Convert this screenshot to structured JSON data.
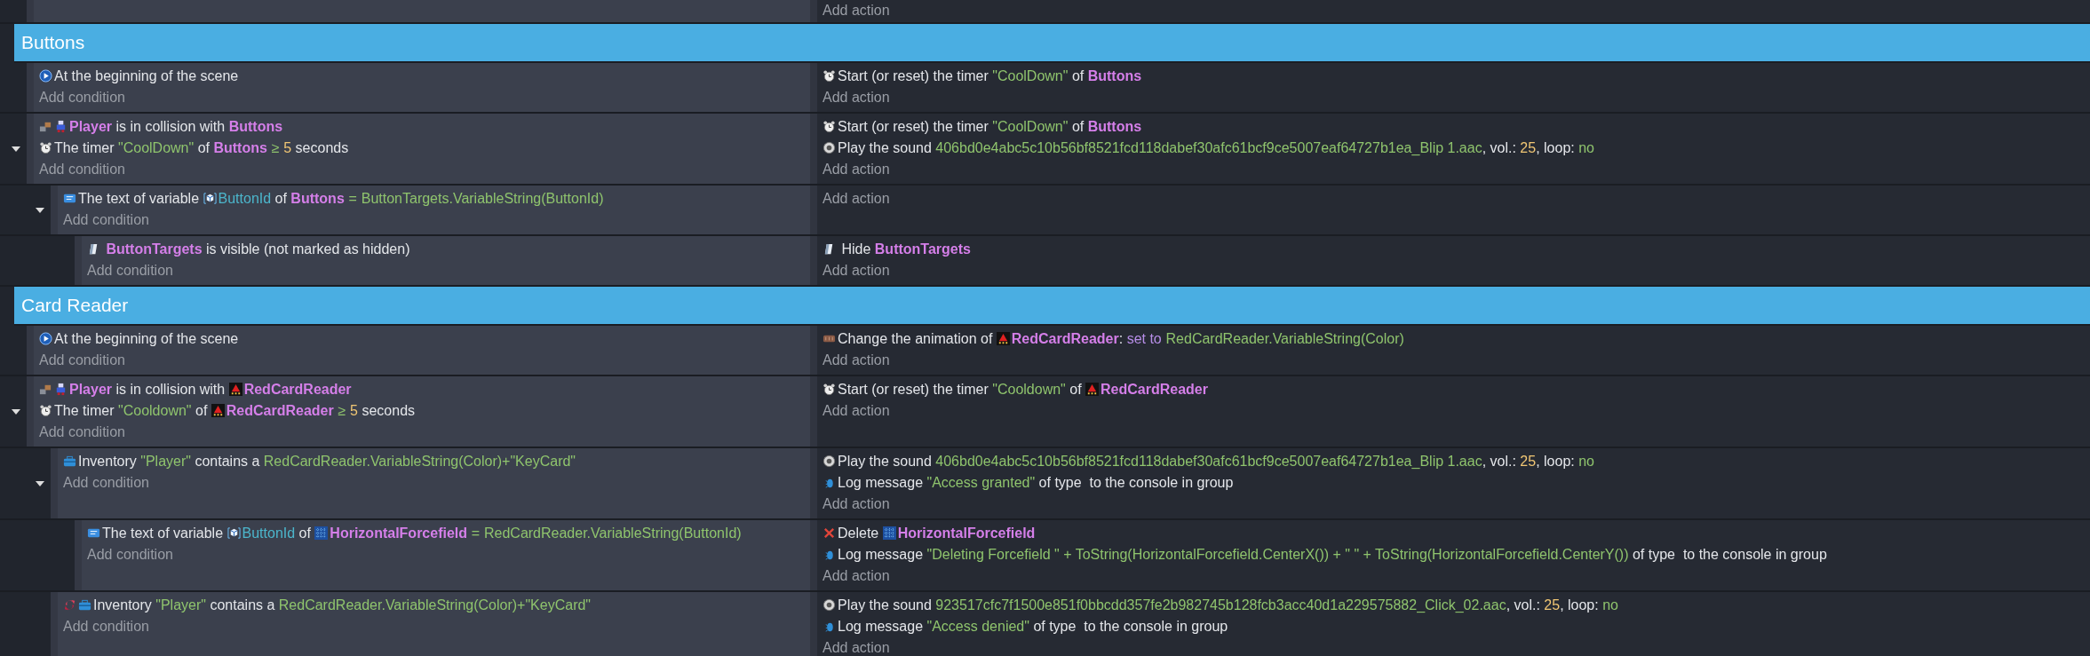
{
  "top_event": {
    "add_action": "Add action"
  },
  "groups": [
    {
      "title": "Buttons",
      "events": [
        {
          "conditions": [
            {
              "kind": "scene-start",
              "parts": [
                {
                  "kind": "text",
                  "text": "At the beginning of the scene"
                }
              ]
            }
          ],
          "add_condition": "Add condition",
          "actions": [
            {
              "kind": "timer",
              "parts": [
                {
                  "kind": "text",
                  "text": "Start (or reset) the timer "
                },
                {
                  "kind": "string",
                  "text": "\"CoolDown\""
                },
                {
                  "kind": "text",
                  "text": " of "
                },
                {
                  "kind": "object",
                  "text": "Buttons"
                }
              ]
            }
          ],
          "add_action": "Add action"
        },
        {
          "conditions": [
            {
              "kind": "collision",
              "parts": [
                {
                  "kind": "player-object",
                  "text": "Player"
                },
                {
                  "kind": "text",
                  "text": " is in collision with "
                },
                {
                  "kind": "object",
                  "text": "Buttons"
                }
              ]
            },
            {
              "kind": "timer",
              "parts": [
                {
                  "kind": "text",
                  "text": "The timer "
                },
                {
                  "kind": "string",
                  "text": "\"CoolDown\""
                },
                {
                  "kind": "text",
                  "text": " of "
                },
                {
                  "kind": "object",
                  "text": "Buttons"
                },
                {
                  "kind": "comparison",
                  "text": "≥"
                },
                {
                  "kind": "number",
                  "text": "5"
                },
                {
                  "kind": "text",
                  "text": " seconds"
                }
              ]
            }
          ],
          "add_condition": "Add condition",
          "actions": [
            {
              "kind": "timer",
              "parts": [
                {
                  "kind": "text",
                  "text": "Start (or reset) the timer "
                },
                {
                  "kind": "string",
                  "text": "\"CoolDown\""
                },
                {
                  "kind": "text",
                  "text": " of "
                },
                {
                  "kind": "object",
                  "text": "Buttons"
                }
              ]
            },
            {
              "kind": "sound",
              "parts": [
                {
                  "kind": "text",
                  "text": "Play the sound "
                },
                {
                  "kind": "string",
                  "text": "406bd0e4abc5c10b56bf8521fcd118dabef30afc61bcf9ce5007eaf64727b1ea_Blip 1.aac"
                },
                {
                  "kind": "text",
                  "text": ", vol.: "
                },
                {
                  "kind": "number",
                  "text": "25"
                },
                {
                  "kind": "text",
                  "text": ", loop: "
                },
                {
                  "kind": "string",
                  "text": "no"
                }
              ]
            }
          ],
          "add_action": "Add action",
          "expanded": true,
          "children": [
            {
              "conditions": [
                {
                  "kind": "variable",
                  "parts": [
                    {
                      "kind": "text",
                      "text": "The text of variable "
                    },
                    {
                      "kind": "variable-param",
                      "text": "ButtonId"
                    },
                    {
                      "kind": "text",
                      "text": " of "
                    },
                    {
                      "kind": "object",
                      "text": "Buttons"
                    },
                    {
                      "kind": "comparison",
                      "text": "="
                    },
                    {
                      "kind": "string",
                      "text": "ButtonTargets.VariableString(ButtonId)"
                    }
                  ]
                }
              ],
              "add_condition": "Add condition",
              "add_action": "Add action",
              "expanded": true,
              "children": [
                {
                  "conditions": [
                    {
                      "kind": "visibility",
                      "parts": [
                        {
                          "kind": "object",
                          "text": " ButtonTargets"
                        },
                        {
                          "kind": "text",
                          "text": " is visible (not marked as hidden)"
                        }
                      ]
                    }
                  ],
                  "add_condition": "Add condition",
                  "actions": [
                    {
                      "kind": "visibility",
                      "parts": [
                        {
                          "kind": "text",
                          "text": " Hide "
                        },
                        {
                          "kind": "object",
                          "text": "ButtonTargets"
                        }
                      ]
                    }
                  ],
                  "add_action": "Add action"
                }
              ]
            }
          ]
        }
      ]
    },
    {
      "title": "Card Reader",
      "events": [
        {
          "conditions": [
            {
              "kind": "scene-start",
              "parts": [
                {
                  "kind": "text",
                  "text": "At the beginning of the scene"
                }
              ]
            }
          ],
          "add_condition": "Add condition",
          "actions": [
            {
              "kind": "animation",
              "parts": [
                {
                  "kind": "text",
                  "text": "Change the animation of "
                },
                {
                  "kind": "reader-object",
                  "text": "RedCardReader"
                },
                {
                  "kind": "text",
                  "text": ": "
                },
                {
                  "kind": "keyword",
                  "text": "set to"
                },
                {
                  "kind": "string",
                  "text": "RedCardReader.VariableString(Color)"
                }
              ]
            }
          ],
          "add_action": "Add action"
        },
        {
          "conditions": [
            {
              "kind": "collision",
              "parts": [
                {
                  "kind": "player-object",
                  "text": "Player"
                },
                {
                  "kind": "text",
                  "text": " is in collision with "
                },
                {
                  "kind": "reader-object",
                  "text": "RedCardReader"
                }
              ]
            },
            {
              "kind": "timer",
              "parts": [
                {
                  "kind": "text",
                  "text": "The timer "
                },
                {
                  "kind": "string",
                  "text": "\"Cooldown\""
                },
                {
                  "kind": "text",
                  "text": " of "
                },
                {
                  "kind": "reader-object",
                  "text": "RedCardReader"
                },
                {
                  "kind": "comparison",
                  "text": "≥"
                },
                {
                  "kind": "number",
                  "text": "5"
                },
                {
                  "kind": "text",
                  "text": " seconds"
                }
              ]
            }
          ],
          "add_condition": "Add condition",
          "actions": [
            {
              "kind": "timer",
              "parts": [
                {
                  "kind": "text",
                  "text": "Start (or reset) the timer "
                },
                {
                  "kind": "string",
                  "text": "\"Cooldown\""
                },
                {
                  "kind": "text",
                  "text": " of "
                },
                {
                  "kind": "reader-object",
                  "text": "RedCardReader"
                }
              ]
            }
          ],
          "add_action": "Add action",
          "expanded": true,
          "children": [
            {
              "conditions": [
                {
                  "kind": "inventory",
                  "inverted": false,
                  "parts": [
                    {
                      "kind": "text",
                      "text": "Inventory "
                    },
                    {
                      "kind": "string",
                      "text": "\"Player\""
                    },
                    {
                      "kind": "text",
                      "text": " contains a "
                    },
                    {
                      "kind": "string",
                      "text": "RedCardReader.VariableString(Color)+\"KeyCard\""
                    }
                  ]
                }
              ],
              "add_condition": "Add condition",
              "actions": [
                {
                  "kind": "sound",
                  "parts": [
                    {
                      "kind": "text",
                      "text": "Play the sound "
                    },
                    {
                      "kind": "string",
                      "text": "406bd0e4abc5c10b56bf8521fcd118dabef30afc61bcf9ce5007eaf64727b1ea_Blip 1.aac"
                    },
                    {
                      "kind": "text",
                      "text": ", vol.: "
                    },
                    {
                      "kind": "number",
                      "text": "25"
                    },
                    {
                      "kind": "text",
                      "text": ", loop: "
                    },
                    {
                      "kind": "string",
                      "text": "no"
                    }
                  ]
                },
                {
                  "kind": "log",
                  "parts": [
                    {
                      "kind": "text",
                      "text": "Log message "
                    },
                    {
                      "kind": "string",
                      "text": "\"Access granted\""
                    },
                    {
                      "kind": "text",
                      "text": " of type  to the console in group"
                    }
                  ]
                }
              ],
              "add_action": "Add action",
              "expanded": true,
              "children": [
                {
                  "conditions": [
                    {
                      "kind": "variable",
                      "parts": [
                        {
                          "kind": "text",
                          "text": "The text of variable "
                        },
                        {
                          "kind": "variable-param",
                          "text": "ButtonId"
                        },
                        {
                          "kind": "text",
                          "text": " of "
                        },
                        {
                          "kind": "forcefield-object",
                          "text": "HorizontalForcefield"
                        },
                        {
                          "kind": "comparison",
                          "text": "="
                        },
                        {
                          "kind": "string",
                          "text": "RedCardReader.VariableString(ButtonId)"
                        }
                      ]
                    }
                  ],
                  "add_condition": "Add condition",
                  "actions": [
                    {
                      "kind": "delete",
                      "parts": [
                        {
                          "kind": "text",
                          "text": "Delete "
                        },
                        {
                          "kind": "forcefield-object",
                          "text": "HorizontalForcefield"
                        }
                      ]
                    },
                    {
                      "kind": "log",
                      "parts": [
                        {
                          "kind": "text",
                          "text": "Log message "
                        },
                        {
                          "kind": "string",
                          "text": "\"Deleting Forcefield \" + ToString(HorizontalForcefield.CenterX()) + \" \" + ToString(HorizontalForcefield.CenterY())"
                        },
                        {
                          "kind": "text",
                          "text": " of type  to the console in group"
                        }
                      ]
                    }
                  ],
                  "add_action": "Add action"
                }
              ]
            },
            {
              "conditions": [
                {
                  "kind": "inventory",
                  "inverted": true,
                  "parts": [
                    {
                      "kind": "text",
                      "text": "Inventory "
                    },
                    {
                      "kind": "string",
                      "text": "\"Player\""
                    },
                    {
                      "kind": "text",
                      "text": " contains a "
                    },
                    {
                      "kind": "string",
                      "text": "RedCardReader.VariableString(Color)+\"KeyCard\""
                    }
                  ]
                }
              ],
              "add_condition": "Add condition",
              "actions": [
                {
                  "kind": "sound",
                  "parts": [
                    {
                      "kind": "text",
                      "text": "Play the sound "
                    },
                    {
                      "kind": "string",
                      "text": "923517cfc7f1500e851f0bbcdd357fe2b982745b128fcb3acc40d1a229575882_Click_02.aac"
                    },
                    {
                      "kind": "text",
                      "text": ", vol.: "
                    },
                    {
                      "kind": "number",
                      "text": "25"
                    },
                    {
                      "kind": "text",
                      "text": ", loop: "
                    },
                    {
                      "kind": "string",
                      "text": "no"
                    }
                  ]
                },
                {
                  "kind": "log",
                  "parts": [
                    {
                      "kind": "text",
                      "text": "Log message "
                    },
                    {
                      "kind": "string",
                      "text": "\"Access denied\""
                    },
                    {
                      "kind": "text",
                      "text": " of type  to the console in group"
                    }
                  ]
                }
              ],
              "add_action": "Add action"
            }
          ]
        }
      ]
    }
  ]
}
